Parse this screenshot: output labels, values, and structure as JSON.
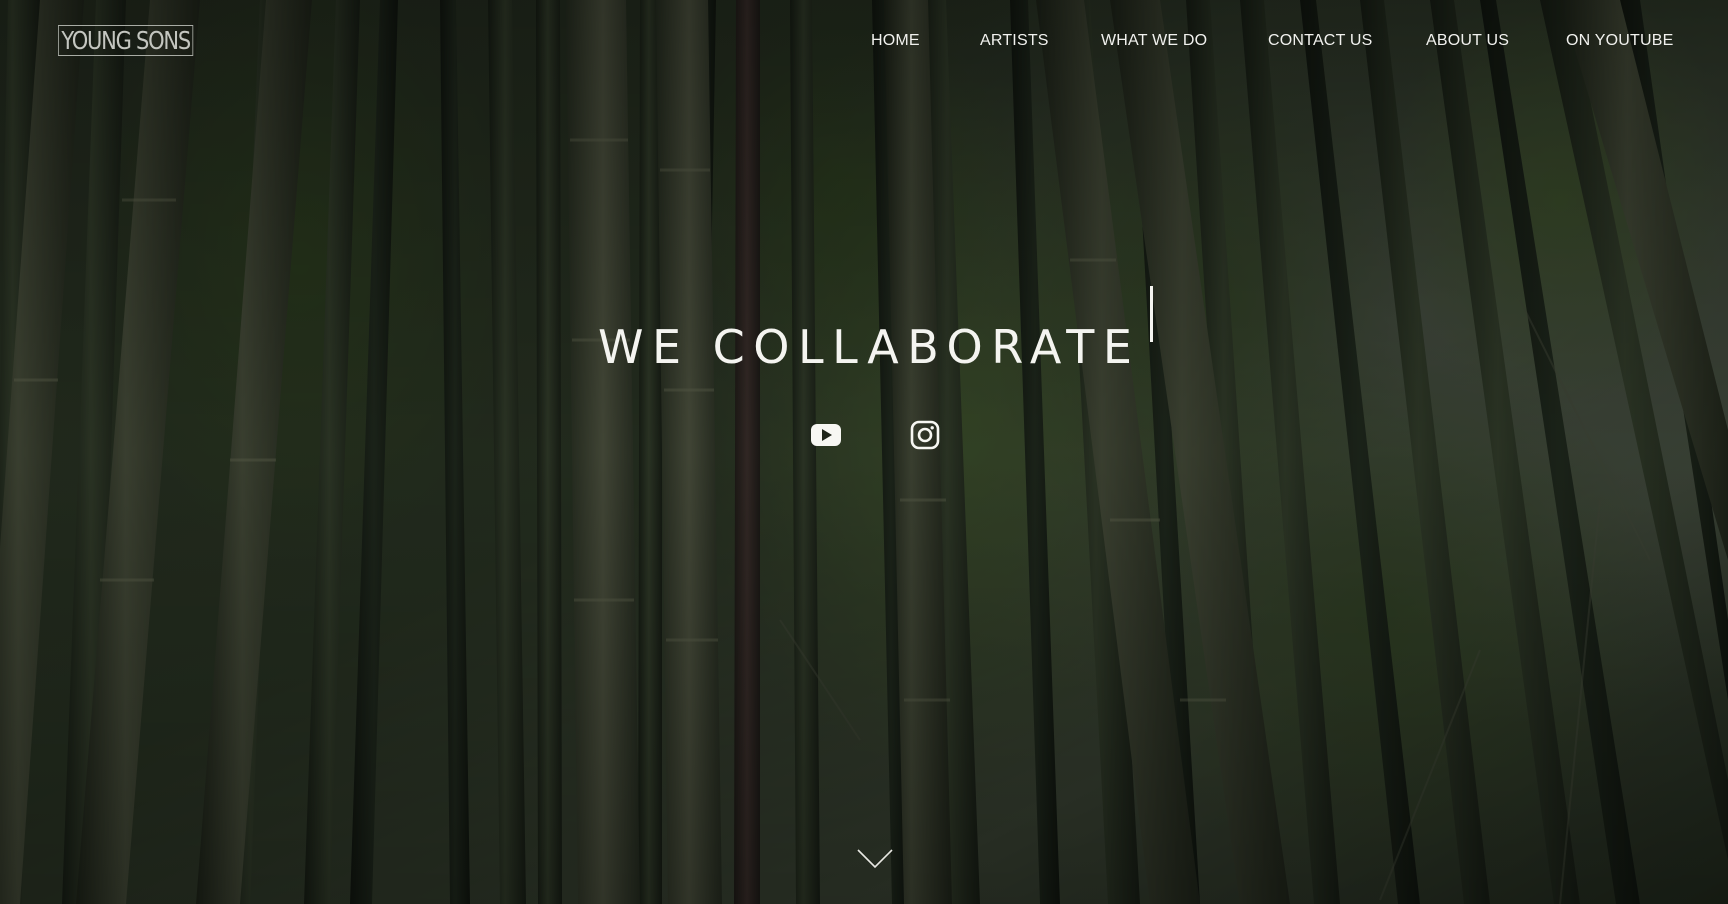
{
  "header": {
    "logo": "YOUNG SONS",
    "nav": [
      {
        "label": "HOME"
      },
      {
        "label": "ARTISTS"
      },
      {
        "label": "WHAT WE DO"
      },
      {
        "label": "CONTACT US"
      },
      {
        "label": "ABOUT US"
      },
      {
        "label": "ON YOUTUBE"
      }
    ]
  },
  "hero": {
    "headline": "WE COLLABORATE",
    "social": [
      {
        "icon": "youtube-icon"
      },
      {
        "icon": "instagram-icon"
      }
    ],
    "scroll_icon": "chevron-down-icon"
  },
  "colors": {
    "text": "#f4f4f0",
    "overlay": "#1c2118",
    "foliage": "#4b6a33"
  }
}
